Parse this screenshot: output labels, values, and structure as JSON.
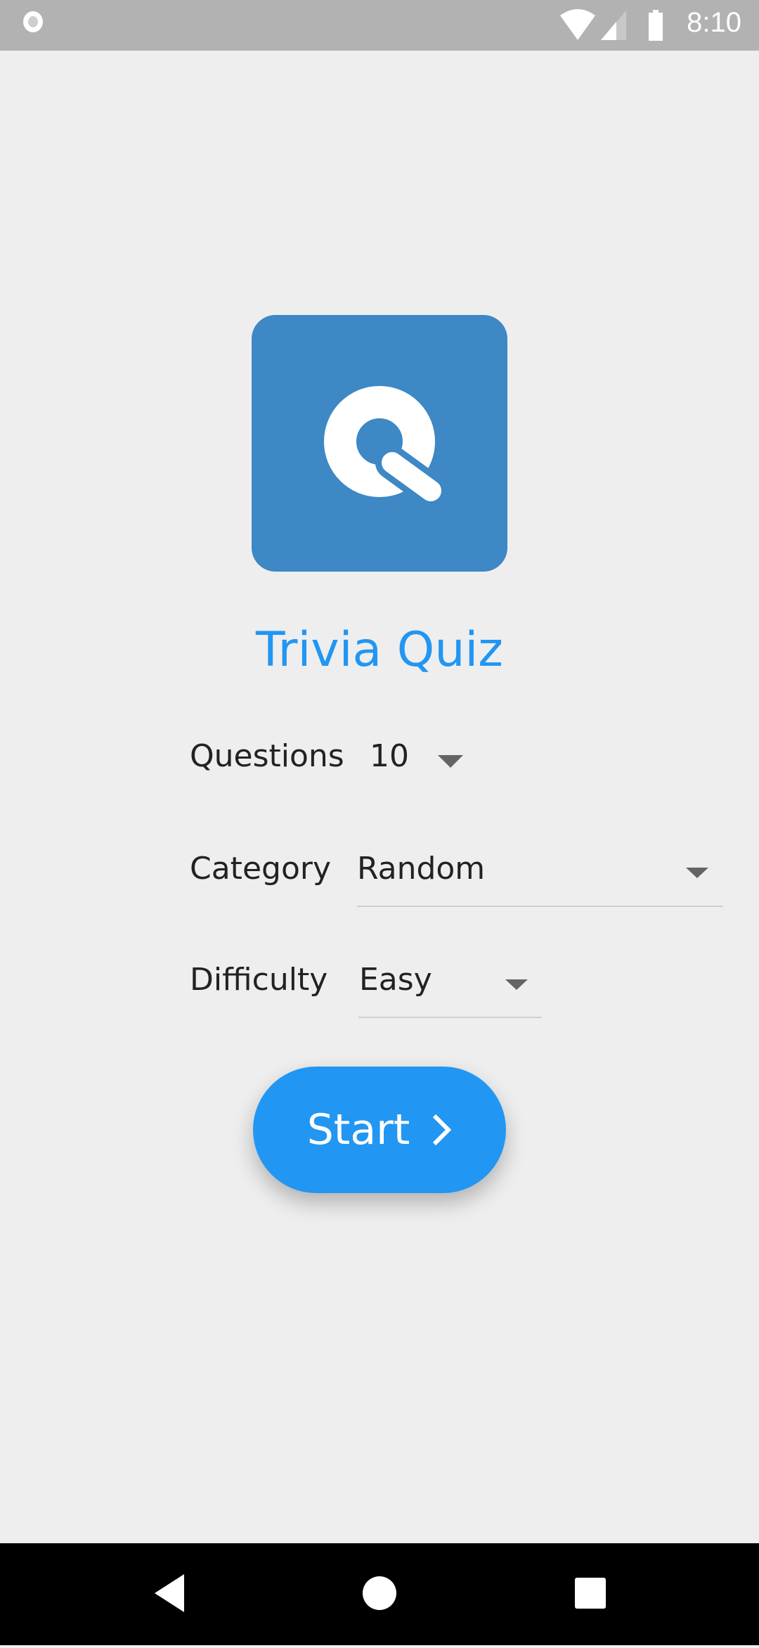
{
  "status_bar": {
    "time": "8:10"
  },
  "app": {
    "title": "Trivia Quiz",
    "logo_letter": "Q",
    "logo_color": "#3d88c5",
    "accent_color": "#2196f3"
  },
  "form": {
    "questions": {
      "label": "Questions",
      "value": "10"
    },
    "category": {
      "label": "Category",
      "value": "Random"
    },
    "difficulty": {
      "label": "Difficulty",
      "value": "Easy"
    }
  },
  "start_button": {
    "label": "Start",
    "icon": "chevron-right-icon"
  },
  "nav_bar": {
    "icons": [
      "back-icon",
      "home-icon",
      "recents-icon"
    ]
  }
}
